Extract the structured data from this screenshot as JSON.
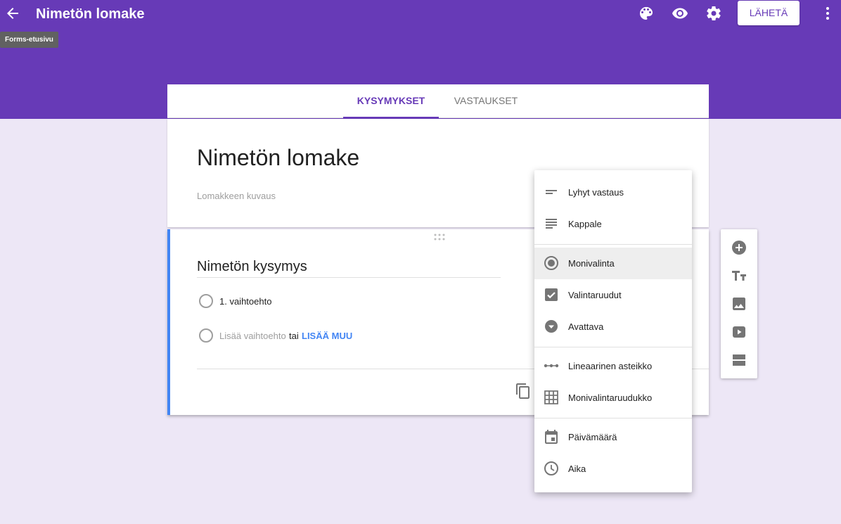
{
  "header": {
    "title": "Nimetön lomake",
    "tooltip": "Forms-etusivu",
    "send_label": "LÄHETÄ",
    "icons": [
      "arrow-back-icon",
      "palette-icon",
      "eye-icon",
      "gear-icon",
      "more-vert-icon"
    ],
    "background": "#673ab7"
  },
  "tabs": [
    {
      "label": "KYSYMYKSET",
      "active": true
    },
    {
      "label": "VASTAUKSET",
      "active": false
    }
  ],
  "form": {
    "title": "Nimetön lomake",
    "description_placeholder": "Lomakkeen kuvaus"
  },
  "question": {
    "title": "Nimetön kysymys",
    "options": [
      "1. vaihtoehto"
    ],
    "add_option": "Lisää vaihtoehto",
    "or_text": "tai",
    "add_other": "LISÄÄ MUU",
    "accent": "#4285f4"
  },
  "type_menu": {
    "items": [
      {
        "label": "Lyhyt vastaus",
        "icon": "short-text-icon"
      },
      {
        "label": "Kappale",
        "icon": "paragraph-icon"
      },
      {
        "label": "Monivalinta",
        "icon": "radio-button-icon",
        "selected": true
      },
      {
        "label": "Valintaruudut",
        "icon": "checkbox-icon"
      },
      {
        "label": "Avattava",
        "icon": "dropdown-icon"
      },
      {
        "label": "Lineaarinen asteikko",
        "icon": "linear-scale-icon"
      },
      {
        "label": "Monivalintaruudukko",
        "icon": "grid-icon"
      },
      {
        "label": "Päivämäärä",
        "icon": "calendar-icon"
      },
      {
        "label": "Aika",
        "icon": "clock-icon"
      }
    ]
  },
  "side_toolbar": [
    "add-question-icon",
    "add-title-icon",
    "add-image-icon",
    "add-video-icon",
    "add-section-icon"
  ]
}
